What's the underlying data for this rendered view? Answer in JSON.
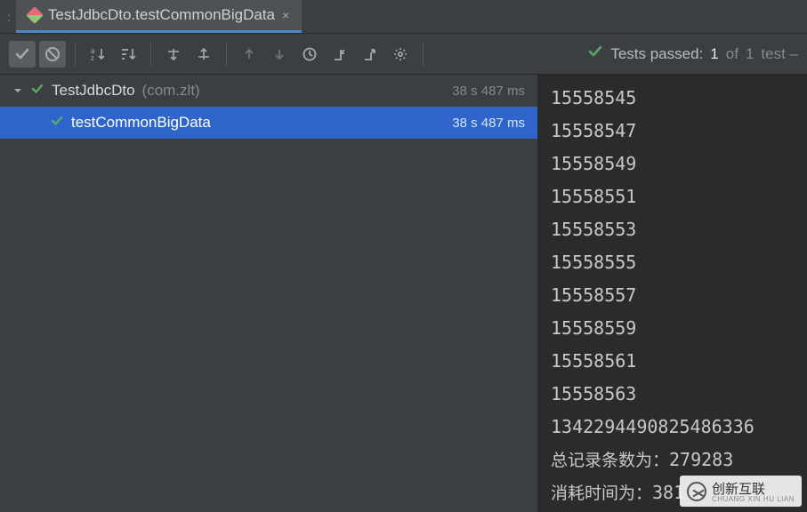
{
  "tab": {
    "title": "TestJdbcDto.testCommonBigData",
    "close_glyph": "×"
  },
  "status": {
    "prefix": "Tests passed:",
    "passed": "1",
    "mid": "of",
    "total": "1",
    "suffix": "test –"
  },
  "tree": {
    "root": {
      "name": "TestJdbcDto",
      "pkg": "(com.zlt)",
      "time": "38 s 487 ms"
    },
    "child": {
      "name": "testCommonBigData",
      "time": "38 s 487 ms"
    }
  },
  "console": {
    "lines": [
      "15558545",
      "15558547",
      "15558549",
      "15558551",
      "15558553",
      "15558555",
      "15558557",
      "15558559",
      "15558561",
      "15558563",
      "1342294490825486336"
    ],
    "summary1_label": "总记录条数为：",
    "summary1_value": "279283",
    "summary2_label": "消耗时间为：",
    "summary2_value": "381"
  },
  "watermark": {
    "text": "创新互联",
    "sub": "CHUANG XIN HU LIAN"
  }
}
